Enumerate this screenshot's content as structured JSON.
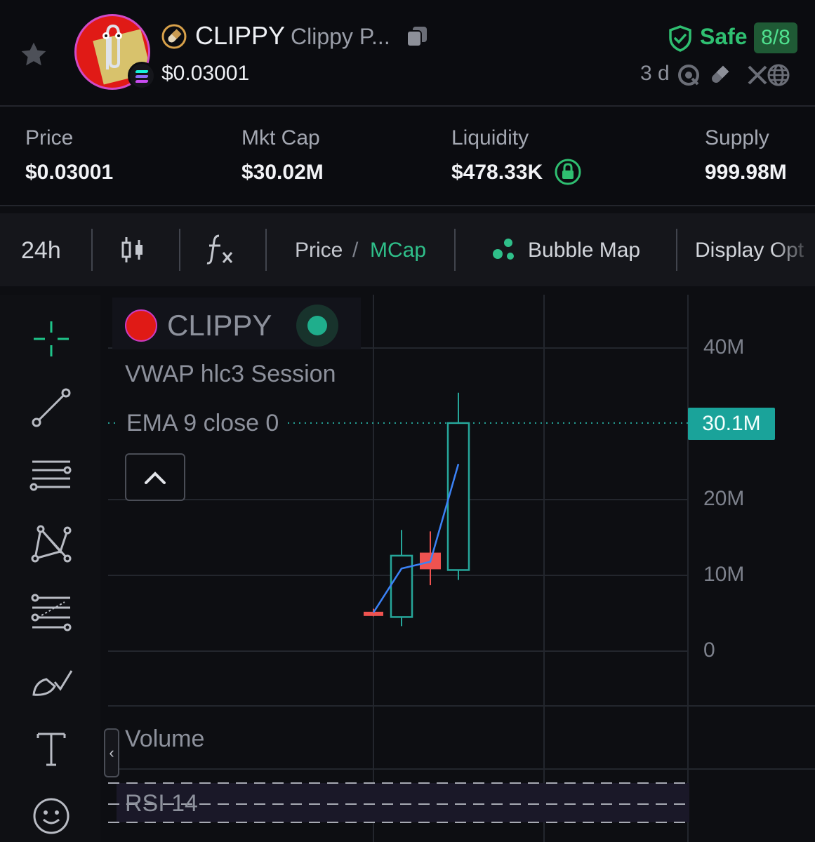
{
  "header": {
    "ticker": "CLIPPY",
    "token_name": "Clippy P...",
    "price": "$0.03001",
    "safety_label": "Safe",
    "safety_score": "8/8",
    "age": "3 d"
  },
  "stats": [
    {
      "label": "Price",
      "value": "$0.03001"
    },
    {
      "label": "Mkt Cap",
      "value": "$30.02M"
    },
    {
      "label": "Liquidity",
      "value": "$478.33K"
    },
    {
      "label": "Supply",
      "value": "999.98M"
    }
  ],
  "toolbar": {
    "timeframe": "24h",
    "price_toggle": "Price",
    "separator": "/",
    "mcap_toggle": "MCap",
    "bubble_map": "Bubble Map",
    "display_options": "Display Opt"
  },
  "chart": {
    "legend_ticker": "CLIPPY",
    "indicator_vwap": "VWAP hlc3 Session",
    "indicator_ema": "EMA 9 close 0",
    "last_price_label": "30.1M",
    "volume_label": "Volume",
    "rsi_label": "RSI 14",
    "side_toggle": "‹"
  },
  "chart_data": {
    "type": "candlestick",
    "ylabel": "",
    "ylim": [
      -5,
      45
    ],
    "yticks": [
      "0",
      "10M",
      "20M",
      "40M"
    ],
    "ytick_values": [
      0,
      10,
      20,
      40
    ],
    "unit": "M",
    "last_price": 30.1,
    "candles": [
      {
        "open": 5.2,
        "close": 4.7,
        "high": 5.6,
        "low": 4.6,
        "direction": "down"
      },
      {
        "open": 4.5,
        "close": 12.6,
        "high": 16.0,
        "low": 3.3,
        "direction": "up"
      },
      {
        "open": 13.0,
        "close": 10.8,
        "high": 15.8,
        "low": 8.7,
        "direction": "down"
      },
      {
        "open": 10.7,
        "close": 30.1,
        "high": 34.1,
        "low": 9.4,
        "direction": "up"
      }
    ],
    "ema_series": [
      5.1,
      10.9,
      11.8,
      24.7
    ],
    "colors": {
      "up": "#26a69a",
      "down": "#ef5350",
      "ema": "#3b82f6",
      "last_price_line": "#26a69a"
    }
  },
  "icons": {
    "star": "star-icon",
    "copy": "copy-icon",
    "shield": "shield-check-icon",
    "lock": "lock-icon",
    "fx": "fx-icon",
    "bubble": "bubble-map-icon"
  }
}
